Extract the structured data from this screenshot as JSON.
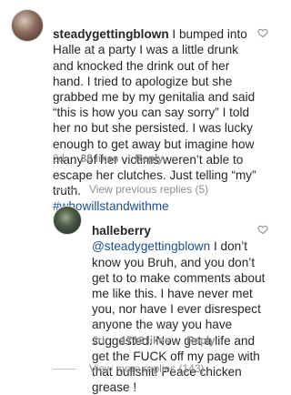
{
  "comment1": {
    "username": "steadygettingblown",
    "body": "I bumped into Halle at a party I was a little drunk and knocked the drink out of her hand. I tried to apologize but she grabbed me by my genitalia and said “this is how you can say sorry” I told her no but she persisted. I was lucky enough to get away but imagine how many of her victims weren’t able to escape her clutches. Just telling “my” truth.",
    "hashtag": "#whowillstandwithme",
    "time": "2d",
    "likes": "38 likes",
    "reply_label": "Reply"
  },
  "view_previous": "View previous replies (5)",
  "comment2": {
    "username": "halleberry",
    "mention": "@steadygettingblown",
    "body": "I don’t know you Bruh, and you don’t get to to make comments about me like this. I have never met you, nor have  I ever disrespect anyone the way you have suggested. Now get a life and get the FUCK off my page with that bullshit! Peace chicken grease !",
    "time": "2d",
    "likes": "1718 likes",
    "reply_label": "Reply"
  },
  "view_more": "View more replies (143)"
}
